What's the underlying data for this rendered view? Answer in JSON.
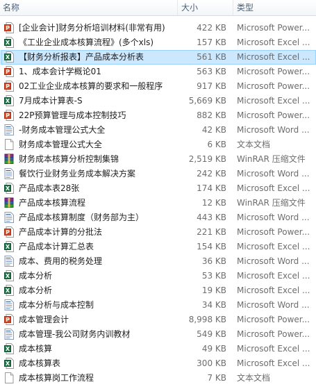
{
  "columns": {
    "name": "名称",
    "size": "大小",
    "type": "类型"
  },
  "files": [
    {
      "icon": "powerpoint-file-icon",
      "name": "[企业会计]财务分析培训材料(非常有用)",
      "size": "422 KB",
      "type": "Microsoft Power..."
    },
    {
      "icon": "excel-file-icon",
      "name": "《工业企业成本核算流程》(多个xls)",
      "size": "157 KB",
      "type": "Microsoft Excel ..."
    },
    {
      "icon": "excel-file-icon",
      "name": "【财务分析报表】产品成本分析表",
      "size": "561 KB",
      "type": "Microsoft Excel ...",
      "selected": true
    },
    {
      "icon": "powerpoint-file-icon",
      "name": "1、成本会计学概论01",
      "size": "563 KB",
      "type": "Microsoft Power..."
    },
    {
      "icon": "powerpoint-file-icon",
      "name": "02工业企业成本核算的要求和一般程序",
      "size": "917 KB",
      "type": "Microsoft Power..."
    },
    {
      "icon": "excel-file-icon",
      "name": "7月成本计算表-S",
      "size": "5,669 KB",
      "type": "Microsoft Excel ..."
    },
    {
      "icon": "powerpoint-file-icon",
      "name": "22P预算管理与成本控制技巧",
      "size": "882 KB",
      "type": "Microsoft Power..."
    },
    {
      "icon": "word-file-icon",
      "name": "-财务成本管理公式大全",
      "size": "42 KB",
      "type": "Microsoft Word ..."
    },
    {
      "icon": "text-file-icon",
      "name": "财务成本管理公式大全",
      "size": "6 KB",
      "type": "文本文档"
    },
    {
      "icon": "winrar-archive-icon",
      "name": "财务成本核算分析控制集锦",
      "size": "2,519 KB",
      "type": "WinRAR 压缩文件"
    },
    {
      "icon": "word-file-icon",
      "name": "餐饮行业财务业务成本解决方案",
      "size": "242 KB",
      "type": "Microsoft Word ..."
    },
    {
      "icon": "excel-file-icon",
      "name": "产品成本表28张",
      "size": "174 KB",
      "type": "Microsoft Excel ..."
    },
    {
      "icon": "winrar-archive-icon",
      "name": "产品成本核算流程",
      "size": "12 KB",
      "type": "WinRAR 压缩文件"
    },
    {
      "icon": "word-file-icon",
      "name": "产品成本核算制度（财务部为主）",
      "size": "443 KB",
      "type": "Microsoft Word ..."
    },
    {
      "icon": "powerpoint-file-icon",
      "name": "产品成本计算的分批法",
      "size": "221 KB",
      "type": "Microsoft Power..."
    },
    {
      "icon": "excel-file-icon",
      "name": "产品成本计算汇总表",
      "size": "154 KB",
      "type": "Microsoft Excel ..."
    },
    {
      "icon": "word-file-icon",
      "name": "成本、费用的税务处理",
      "size": "36 KB",
      "type": "Microsoft Word ..."
    },
    {
      "icon": "excel-file-icon",
      "name": "成本分析",
      "size": "53 KB",
      "type": "Microsoft Excel ..."
    },
    {
      "icon": "excel-file-icon",
      "name": "成本分析",
      "size": "19 KB",
      "type": "Microsoft Excel ..."
    },
    {
      "icon": "word-file-icon",
      "name": "成本分析与成本控制",
      "size": "34 KB",
      "type": "Microsoft Word ..."
    },
    {
      "icon": "powerpoint-file-icon",
      "name": "成本管理会计",
      "size": "8,998 KB",
      "type": "Microsoft Power..."
    },
    {
      "icon": "word-file-icon",
      "name": "成本管理-我公司财务内训教材",
      "size": "549 KB",
      "type": "Microsoft Power..."
    },
    {
      "icon": "excel-file-icon",
      "name": "成本核算",
      "size": "49 KB",
      "type": "Microsoft Excel ..."
    },
    {
      "icon": "excel-file-icon",
      "name": "成本核算表",
      "size": "300 KB",
      "type": "Microsoft Excel ..."
    },
    {
      "icon": "text-file-icon",
      "name": "成本核算岗工作流程",
      "size": "7 KB",
      "type": "文本文档"
    }
  ]
}
